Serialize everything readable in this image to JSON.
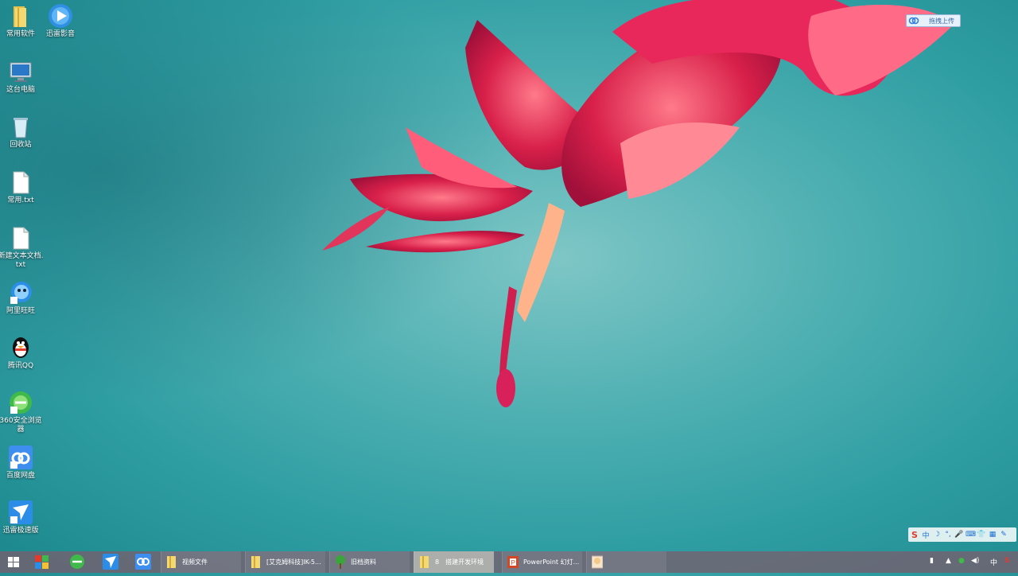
{
  "desktop": {
    "icons": [
      {
        "label": "常用软件",
        "icon": "folder-icon"
      },
      {
        "label": "迅雷影音",
        "icon": "xunlei-player-icon"
      },
      {
        "label": "这台电脑",
        "icon": "computer-icon"
      },
      {
        "label": "回收站",
        "icon": "recycle-bin-icon"
      },
      {
        "label": "常用.txt",
        "icon": "text-file-icon"
      },
      {
        "label": "新建文本文档.txt",
        "icon": "text-file-icon"
      },
      {
        "label": "阿里旺旺",
        "icon": "aliwangwang-icon"
      },
      {
        "label": "腾讯QQ",
        "icon": "qq-penguin-icon"
      },
      {
        "label": "360安全浏览器",
        "icon": "browser-360-icon"
      },
      {
        "label": "百度网盘",
        "icon": "baidu-netdisk-icon"
      },
      {
        "label": "迅雷极速版",
        "icon": "xunlei-icon"
      }
    ]
  },
  "upload_button": {
    "label": "拖拽上传",
    "icon": "baidu-netdisk-icon"
  },
  "ime": {
    "logo": "S",
    "mode": "中"
  },
  "taskbar": {
    "pinned": [
      {
        "name": "start-button",
        "icon": "windows-logo-icon"
      },
      {
        "name": "pinned-app-1",
        "icon": "colorful-app-icon"
      },
      {
        "name": "pinned-360-browser",
        "icon": "browser-360-icon"
      },
      {
        "name": "pinned-xunlei",
        "icon": "xunlei-icon"
      },
      {
        "name": "pinned-baidu-netdisk",
        "icon": "baidu-netdisk-icon"
      }
    ],
    "windows": [
      {
        "label": "视频文件",
        "icon": "folder-icon"
      },
      {
        "label": "[艾克姆科技]IK-5...",
        "icon": "folder-icon"
      },
      {
        "label": "旧档资料",
        "icon": "tree-icon"
      },
      {
        "label": "8　搭建开发环境",
        "icon": "folder-icon"
      },
      {
        "label": "PowerPoint 幻灯...",
        "icon": "powerpoint-icon"
      },
      {
        "label": "",
        "icon": "image-viewer-icon"
      }
    ],
    "tray": {
      "ime_label": "中",
      "sogou": "S"
    }
  }
}
